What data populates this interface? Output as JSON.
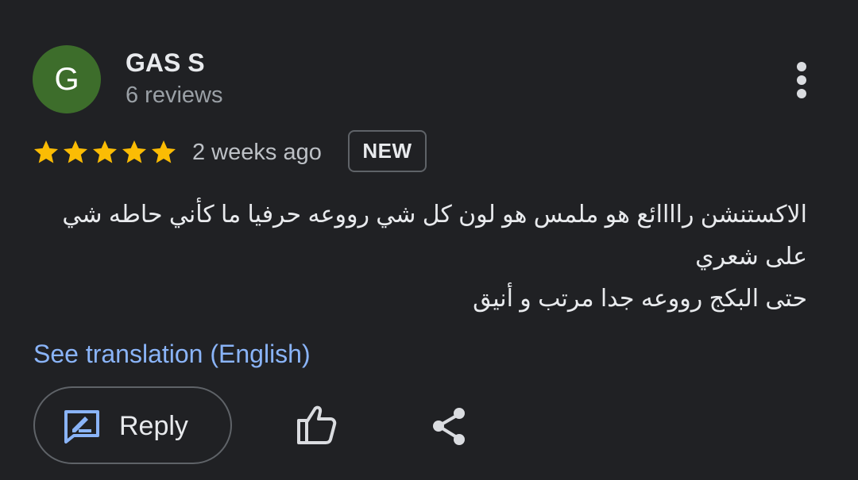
{
  "review": {
    "author": {
      "avatar_letter": "G",
      "avatar_color": "#3d6d2b",
      "name": "GAS S",
      "review_count": "6 reviews"
    },
    "rating": 5,
    "rating_max": 5,
    "star_color": "#fbbc04",
    "date": "2 weeks ago",
    "badge": "NEW",
    "text_lines": [
      "الاكستنشن راااائع هو ملمس هو لون كل شي رووعه حرفيا ما كأني حاطه شي",
      "على شعري",
      "حتى البكج رووعه جدا مرتب و أنيق"
    ],
    "translate_link": "See translation (English)",
    "link_color": "#8ab4f8"
  },
  "actions": {
    "reply_label": "Reply",
    "reply_icon": "reply-icon",
    "like_icon": "thumb-up-icon",
    "share_icon": "share-icon",
    "menu_icon": "more-vert-icon"
  }
}
